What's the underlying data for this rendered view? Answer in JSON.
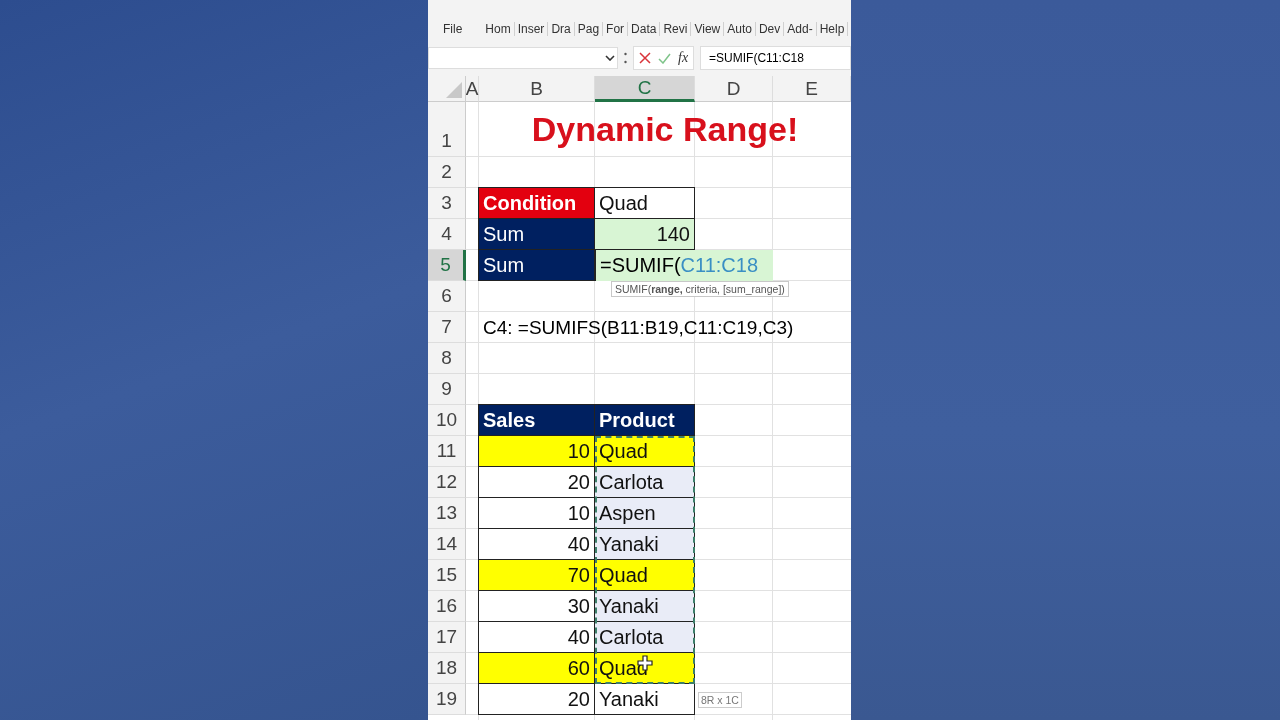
{
  "ribbon_tabs": [
    "File",
    "Hom",
    "Inser",
    "Dra",
    "Pag",
    "For",
    "Data",
    "Revi",
    "View",
    "Auto",
    "Dev",
    "Add-",
    "Help"
  ],
  "formula_bar": {
    "function_button": "fx",
    "value": "=SUMIF(C11:C18"
  },
  "columns": [
    {
      "label": "A",
      "selected": false
    },
    {
      "label": "B",
      "selected": false
    },
    {
      "label": "C",
      "selected": true
    },
    {
      "label": "D",
      "selected": false
    },
    {
      "label": "E",
      "selected": false
    }
  ],
  "rows": [
    {
      "label": "1",
      "selected": false
    },
    {
      "label": "2",
      "selected": false
    },
    {
      "label": "3",
      "selected": false
    },
    {
      "label": "4",
      "selected": false
    },
    {
      "label": "5",
      "selected": true
    },
    {
      "label": "6",
      "selected": false
    },
    {
      "label": "7",
      "selected": false
    },
    {
      "label": "8",
      "selected": false
    },
    {
      "label": "9",
      "selected": false
    },
    {
      "label": "10",
      "selected": false
    },
    {
      "label": "11",
      "selected": false
    },
    {
      "label": "12",
      "selected": false
    },
    {
      "label": "13",
      "selected": false
    },
    {
      "label": "14",
      "selected": false
    },
    {
      "label": "15",
      "selected": false
    },
    {
      "label": "16",
      "selected": false
    },
    {
      "label": "17",
      "selected": false
    },
    {
      "label": "18",
      "selected": false
    },
    {
      "label": "19",
      "selected": false
    }
  ],
  "title": "Dynamic Range!",
  "summary": [
    {
      "kind": "condition",
      "label": "Condition",
      "value": "Quad"
    },
    {
      "kind": "result",
      "label": "Sum",
      "value": "140"
    },
    {
      "kind": "editing",
      "label": "Sum",
      "formula": "=SUMIF(",
      "reference": "C11:C18"
    }
  ],
  "function_tooltip": "SUMIF(**range,** criteria, [sum_range])",
  "note": "C4: =SUMIFS(B11:B19,C11:C19,C3)",
  "sales_table": {
    "columns": [
      "Sales",
      "Product"
    ],
    "rows": [
      {
        "sales": "10",
        "product": "Quad",
        "highlighted": true
      },
      {
        "sales": "20",
        "product": "Carlota",
        "highlighted": false,
        "in_range": true
      },
      {
        "sales": "10",
        "product": "Aspen",
        "highlighted": false,
        "in_range": true
      },
      {
        "sales": "40",
        "product": "Yanaki",
        "highlighted": false,
        "in_range": true
      },
      {
        "sales": "70",
        "product": "Quad",
        "highlighted": true
      },
      {
        "sales": "30",
        "product": "Yanaki",
        "highlighted": false,
        "in_range": true
      },
      {
        "sales": "40",
        "product": "Carlota",
        "highlighted": false,
        "in_range": true
      },
      {
        "sales": "60",
        "product": "Quad",
        "highlighted": true
      },
      {
        "sales": "20",
        "product": "Yanaki",
        "highlighted": false,
        "in_range": false
      }
    ]
  },
  "selection_size": "8R x 1C"
}
